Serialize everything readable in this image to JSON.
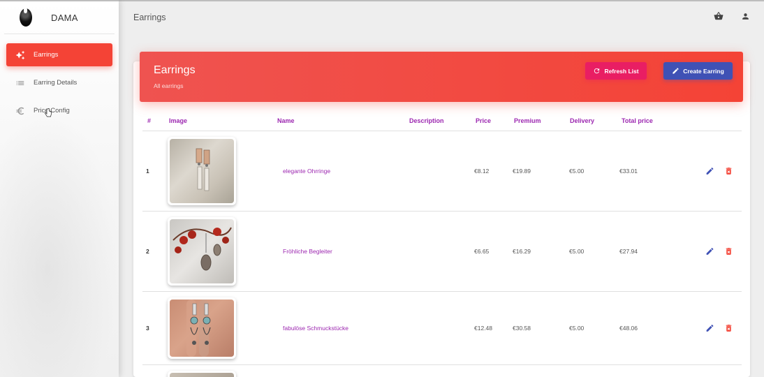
{
  "app": {
    "brand": "DAMA",
    "page_title": "Earrings"
  },
  "sidebar": {
    "items": [
      {
        "label": "Earrings",
        "icon": "sparkle-icon",
        "active": true
      },
      {
        "label": "Earring Details",
        "icon": "list-icon",
        "active": false
      },
      {
        "label": "Price Config",
        "icon": "euro-icon",
        "active": false
      }
    ]
  },
  "topbar": {
    "icons": [
      "basket-icon",
      "person-icon"
    ]
  },
  "card": {
    "title": "Earrings",
    "subtitle": "All earrings",
    "refresh_label": "Refresh List",
    "create_label": "Create Earring"
  },
  "table": {
    "headers": [
      "#",
      "Image",
      "Name",
      "Description",
      "Price",
      "Premium",
      "Delivery",
      "Total price"
    ],
    "rows": [
      {
        "num": "1",
        "name": "elegante Ohrringe",
        "description": "",
        "price": "€8.12",
        "premium": "€19.89",
        "delivery": "€5.00",
        "total": "€33.01"
      },
      {
        "num": "2",
        "name": "Fröhliche Begleiter",
        "description": "",
        "price": "€6.65",
        "premium": "€16.29",
        "delivery": "€5.00",
        "total": "€27.94"
      },
      {
        "num": "3",
        "name": "fabulöse Schmuckstücke",
        "description": "",
        "price": "€12.48",
        "premium": "€30.58",
        "delivery": "€5.00",
        "total": "€48.06"
      }
    ]
  },
  "colors": {
    "primary_red": "#f44336",
    "accent_pink": "#e91e63",
    "accent_indigo": "#3f51b5",
    "header_text_purple": "#9c27b0"
  }
}
